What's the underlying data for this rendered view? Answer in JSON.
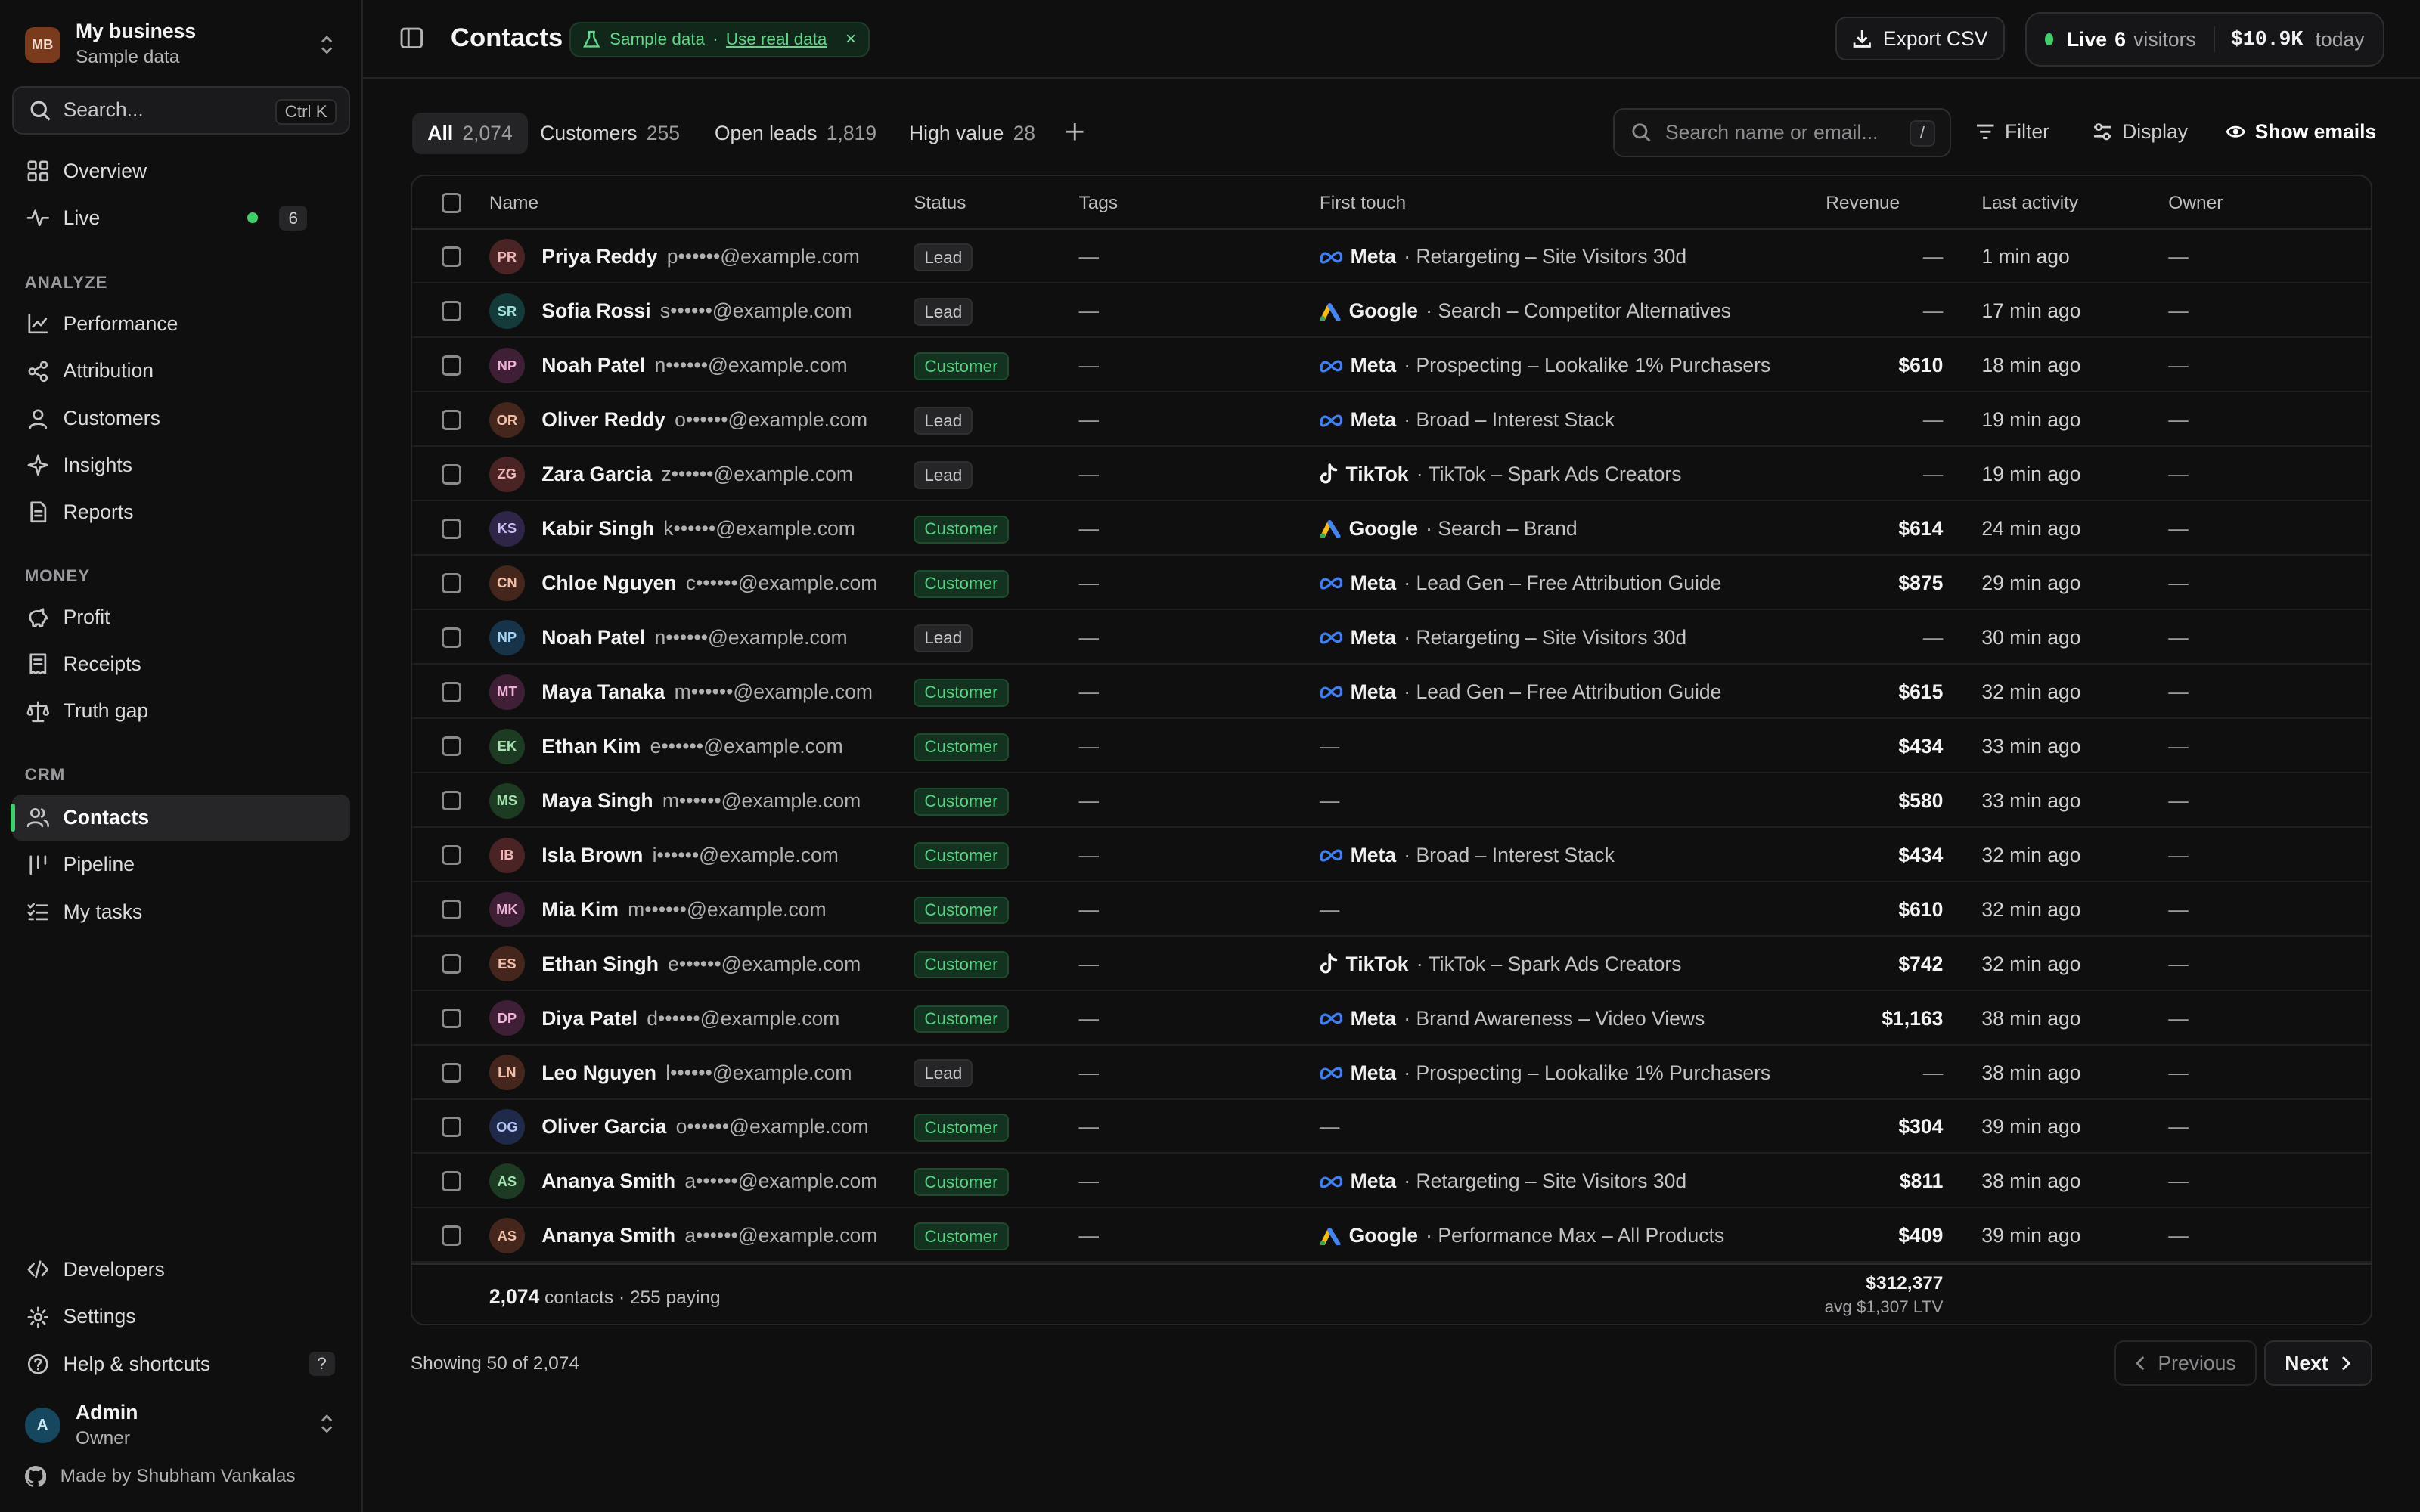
{
  "business": {
    "avatar": "MB",
    "name": "My business",
    "sub": "Sample data"
  },
  "search": {
    "label": "Search...",
    "shortcut": "Ctrl K"
  },
  "nav_top": [
    {
      "label": "Overview",
      "icon": "grid-icon"
    },
    {
      "label": "Live",
      "icon": "activity-icon",
      "count": "6"
    }
  ],
  "sections": {
    "analyze": "ANALYZE",
    "money": "MONEY",
    "crm": "CRM"
  },
  "nav_analyze": [
    {
      "label": "Performance",
      "icon": "chart-line-icon"
    },
    {
      "label": "Attribution",
      "icon": "share-nodes-icon"
    },
    {
      "label": "Customers",
      "icon": "user-icon"
    },
    {
      "label": "Insights",
      "icon": "sparkle-icon"
    },
    {
      "label": "Reports",
      "icon": "document-icon"
    }
  ],
  "nav_money": [
    {
      "label": "Profit",
      "icon": "piggy-bank-icon"
    },
    {
      "label": "Receipts",
      "icon": "receipt-icon"
    },
    {
      "label": "Truth gap",
      "icon": "scale-icon"
    }
  ],
  "nav_crm": [
    {
      "label": "Contacts",
      "icon": "users-icon",
      "active": true
    },
    {
      "label": "Pipeline",
      "icon": "kanban-icon"
    },
    {
      "label": "My tasks",
      "icon": "checklist-icon"
    }
  ],
  "nav_bottom": [
    {
      "label": "Developers",
      "icon": "code-icon"
    },
    {
      "label": "Settings",
      "icon": "gear-icon"
    },
    {
      "label": "Help & shortcuts",
      "icon": "help-circle-icon",
      "key": "?"
    }
  ],
  "user": {
    "avatar": "A",
    "name": "Admin",
    "role": "Owner"
  },
  "made_by": "Made by Shubham Vankalas",
  "header": {
    "title": "Contacts",
    "sample_label": "Sample data",
    "sample_sep": "·",
    "sample_link": "Use real data",
    "sample_close": "×",
    "export": "Export CSV",
    "live_label": "Live",
    "live_count": "6",
    "live_visitors": "visitors",
    "live_amount": "$10.9K",
    "live_today": "today"
  },
  "tabs": [
    {
      "label": "All",
      "count": "2,074",
      "active": true
    },
    {
      "label": "Customers",
      "count": "255"
    },
    {
      "label": "Open leads",
      "count": "1,819"
    },
    {
      "label": "High value",
      "count": "28"
    }
  ],
  "toolbar": {
    "search_placeholder": "Search name or email...",
    "search_key": "/",
    "filter": "Filter",
    "display": "Display",
    "show_emails": "Show emails"
  },
  "columns": {
    "name": "Name",
    "status": "Status",
    "tags": "Tags",
    "first_touch": "First touch",
    "revenue": "Revenue",
    "last_activity": "Last activity",
    "owner": "Owner"
  },
  "colors": {
    "accent_green": "#3ecf6a",
    "meta_blue": "#3b82f6",
    "google_blue": "#4285f4"
  },
  "rows": [
    {
      "initials": "PR",
      "name": "Priya Reddy",
      "email": "p••••••@example.com",
      "status": "Lead",
      "tags": "—",
      "platform": "Meta",
      "campaign": "· Retargeting – Site Visitors 30d",
      "revenue": "—",
      "activity": "1 min ago",
      "owner": "—",
      "avbg": "#4a2424",
      "avfg": "#f0b5b5"
    },
    {
      "initials": "SR",
      "name": "Sofia Rossi",
      "email": "s••••••@example.com",
      "status": "Lead",
      "tags": "—",
      "platform": "Google",
      "campaign": "· Search – Competitor Alternatives",
      "revenue": "—",
      "activity": "17 min ago",
      "owner": "—",
      "avbg": "#143a3a",
      "avfg": "#9fe3df"
    },
    {
      "initials": "NP",
      "name": "Noah Patel",
      "email": "n••••••@example.com",
      "status": "Customer",
      "tags": "—",
      "platform": "Meta",
      "campaign": "· Prospecting – Lookalike 1% Purchasers",
      "revenue": "$610",
      "activity": "18 min ago",
      "owner": "—",
      "avbg": "#3f1f35",
      "avfg": "#f0b2d9"
    },
    {
      "initials": "OR",
      "name": "Oliver Reddy",
      "email": "o••••••@example.com",
      "status": "Lead",
      "tags": "—",
      "platform": "Meta",
      "campaign": "· Broad – Interest Stack",
      "revenue": "—",
      "activity": "19 min ago",
      "owner": "—",
      "avbg": "#45261c",
      "avfg": "#f2bfa8"
    },
    {
      "initials": "ZG",
      "name": "Zara Garcia",
      "email": "z••••••@example.com",
      "status": "Lead",
      "tags": "—",
      "platform": "TikTok",
      "campaign": "· TikTok – Spark Ads Creators",
      "revenue": "—",
      "activity": "19 min ago",
      "owner": "—",
      "avbg": "#4a2424",
      "avfg": "#f0b5b5"
    },
    {
      "initials": "KS",
      "name": "Kabir Singh",
      "email": "k••••••@example.com",
      "status": "Customer",
      "tags": "—",
      "platform": "Google",
      "campaign": "· Search – Brand",
      "revenue": "$614",
      "activity": "24 min ago",
      "owner": "—",
      "avbg": "#2e2548",
      "avfg": "#cbbdf5"
    },
    {
      "initials": "CN",
      "name": "Chloe Nguyen",
      "email": "c••••••@example.com",
      "status": "Customer",
      "tags": "—",
      "platform": "Meta",
      "campaign": "· Lead Gen – Free Attribution Guide",
      "revenue": "$875",
      "activity": "29 min ago",
      "owner": "—",
      "avbg": "#45261c",
      "avfg": "#f2bfa8"
    },
    {
      "initials": "NP",
      "name": "Noah Patel",
      "email": "n••••••@example.com",
      "status": "Lead",
      "tags": "—",
      "platform": "Meta",
      "campaign": "· Retargeting – Site Visitors 30d",
      "revenue": "—",
      "activity": "30 min ago",
      "owner": "—",
      "avbg": "#16334a",
      "avfg": "#a8d4f5"
    },
    {
      "initials": "MT",
      "name": "Maya Tanaka",
      "email": "m••••••@example.com",
      "status": "Customer",
      "tags": "—",
      "platform": "Meta",
      "campaign": "· Lead Gen – Free Attribution Guide",
      "revenue": "$615",
      "activity": "32 min ago",
      "owner": "—",
      "avbg": "#3f1f35",
      "avfg": "#f0b2d9"
    },
    {
      "initials": "EK",
      "name": "Ethan Kim",
      "email": "e••••••@example.com",
      "status": "Customer",
      "tags": "—",
      "platform": "",
      "campaign": "—",
      "revenue": "$434",
      "activity": "33 min ago",
      "owner": "—",
      "avbg": "#1d3a22",
      "avfg": "#a5e3b0"
    },
    {
      "initials": "MS",
      "name": "Maya Singh",
      "email": "m••••••@example.com",
      "status": "Customer",
      "tags": "—",
      "platform": "",
      "campaign": "—",
      "revenue": "$580",
      "activity": "33 min ago",
      "owner": "—",
      "avbg": "#1d3a22",
      "avfg": "#a5e3b0"
    },
    {
      "initials": "IB",
      "name": "Isla Brown",
      "email": "i••••••@example.com",
      "status": "Customer",
      "tags": "—",
      "platform": "Meta",
      "campaign": "· Broad – Interest Stack",
      "revenue": "$434",
      "activity": "32 min ago",
      "owner": "—",
      "avbg": "#4a2424",
      "avfg": "#f0b5b5"
    },
    {
      "initials": "MK",
      "name": "Mia Kim",
      "email": "m••••••@example.com",
      "status": "Customer",
      "tags": "—",
      "platform": "",
      "campaign": "—",
      "revenue": "$610",
      "activity": "32 min ago",
      "owner": "—",
      "avbg": "#3f1f35",
      "avfg": "#f0b2d9"
    },
    {
      "initials": "ES",
      "name": "Ethan Singh",
      "email": "e••••••@example.com",
      "status": "Customer",
      "tags": "—",
      "platform": "TikTok",
      "campaign": "· TikTok – Spark Ads Creators",
      "revenue": "$742",
      "activity": "32 min ago",
      "owner": "—",
      "avbg": "#45261c",
      "avfg": "#f2bfa8"
    },
    {
      "initials": "DP",
      "name": "Diya Patel",
      "email": "d••••••@example.com",
      "status": "Customer",
      "tags": "—",
      "platform": "Meta",
      "campaign": "· Brand Awareness – Video Views",
      "revenue": "$1,163",
      "activity": "38 min ago",
      "owner": "—",
      "avbg": "#3f1f35",
      "avfg": "#f0b2d9"
    },
    {
      "initials": "LN",
      "name": "Leo Nguyen",
      "email": "l••••••@example.com",
      "status": "Lead",
      "tags": "—",
      "platform": "Meta",
      "campaign": "· Prospecting – Lookalike 1% Purchasers",
      "revenue": "—",
      "activity": "38 min ago",
      "owner": "—",
      "avbg": "#45261c",
      "avfg": "#f2bfa8"
    },
    {
      "initials": "OG",
      "name": "Oliver Garcia",
      "email": "o••••••@example.com",
      "status": "Customer",
      "tags": "—",
      "platform": "",
      "campaign": "—",
      "revenue": "$304",
      "activity": "39 min ago",
      "owner": "—",
      "avbg": "#1f2a4a",
      "avfg": "#b2c3f5"
    },
    {
      "initials": "AS",
      "name": "Ananya Smith",
      "email": "a••••••@example.com",
      "status": "Customer",
      "tags": "—",
      "platform": "Meta",
      "campaign": "· Retargeting – Site Visitors 30d",
      "revenue": "$811",
      "activity": "38 min ago",
      "owner": "—",
      "avbg": "#1d3a22",
      "avfg": "#a5e3b0"
    },
    {
      "initials": "AS",
      "name": "Ananya Smith",
      "email": "a••••••@example.com",
      "status": "Customer",
      "tags": "—",
      "platform": "Google",
      "campaign": "· Performance Max – All Products",
      "revenue": "$409",
      "activity": "39 min ago",
      "owner": "—",
      "avbg": "#45261c",
      "avfg": "#f2bfa8"
    }
  ],
  "footer": {
    "count": "2,074",
    "count_suffix": "contacts · 255 paying",
    "total": "$312,377",
    "avg": "avg $1,307 LTV"
  },
  "pagination": {
    "showing": "Showing 50 of 2,074",
    "prev": "Previous",
    "next": "Next"
  }
}
